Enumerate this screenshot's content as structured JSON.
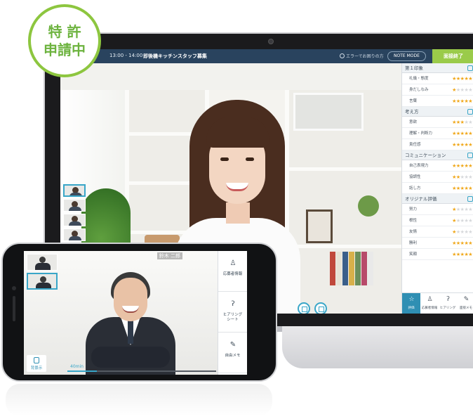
{
  "badge": {
    "line1": "特 許",
    "line2": "申請中"
  },
  "laptop": {
    "topbar": {
      "time": "13:00 - 14:00",
      "title": "即後機キッチンスタッフ募集",
      "error_link": "エラーでお困りの方",
      "note_button": "NOTE MODE",
      "end_button": "面接終了"
    },
    "panel": {
      "sections": [
        {
          "title": "第１印象",
          "rows": [
            {
              "label": "礼儀・態度",
              "stars": 5
            },
            {
              "label": "身だしなみ",
              "stars": 1
            },
            {
              "label": "言葉",
              "stars": 5
            }
          ]
        },
        {
          "title": "考え方",
          "rows": [
            {
              "label": "意欲",
              "stars": 3
            },
            {
              "label": "理解・判断力",
              "stars": 5
            },
            {
              "label": "責任感",
              "stars": 5
            }
          ]
        },
        {
          "title": "コミュニケーション",
          "rows": [
            {
              "label": "自己表現力",
              "stars": 5
            },
            {
              "label": "協調性",
              "stars": 2
            },
            {
              "label": "話し方",
              "stars": 5
            }
          ]
        },
        {
          "title": "オリジナル評価",
          "rows": [
            {
              "label": "努力",
              "stars": 1
            },
            {
              "label": "根性",
              "stars": 1
            },
            {
              "label": "友情",
              "stars": 1
            },
            {
              "label": "勝利",
              "stars": 5
            },
            {
              "label": "笑顔",
              "stars": 5
            }
          ]
        }
      ],
      "tabs": [
        {
          "label": "評価",
          "icon": "star-icon",
          "glyph": "☆"
        },
        {
          "label": "応募者情報",
          "icon": "person-icon",
          "glyph": "♙"
        },
        {
          "label": "ヒアリング",
          "icon": "ear-icon",
          "glyph": "ʔ"
        },
        {
          "label": "面接メモ",
          "icon": "pen-icon",
          "glyph": "✎"
        }
      ]
    }
  },
  "phone": {
    "candidate_name": "鈴木 二郎",
    "back_label": "背景示",
    "timer": "40min",
    "progress": 0.2,
    "side_buttons": [
      {
        "label": "応募者情報",
        "icon": "person-icon",
        "glyph": "♙"
      },
      {
        "label": "ヒアリング\nシート",
        "icon": "ear-icon",
        "glyph": "ʔ"
      },
      {
        "label": "自由メモ",
        "icon": "memo-icon",
        "glyph": "✎"
      }
    ]
  },
  "colors": {
    "accent": "#39a6c8",
    "end_button": "#9acb4a",
    "topbar": "#29435e",
    "badge": "#8dc63f",
    "star_on": "#f0a81c"
  }
}
